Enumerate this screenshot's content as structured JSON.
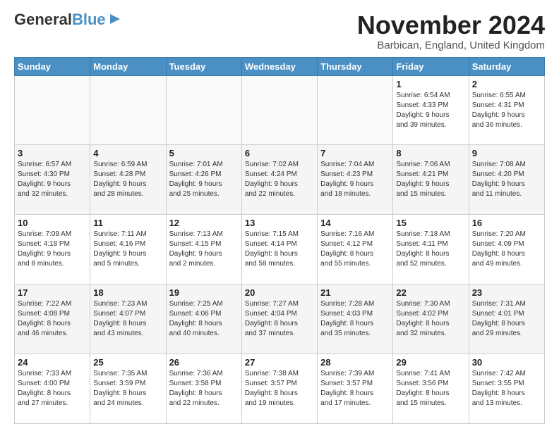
{
  "header": {
    "logo_line1": "General",
    "logo_line2": "Blue",
    "month": "November 2024",
    "location": "Barbican, England, United Kingdom"
  },
  "days_of_week": [
    "Sunday",
    "Monday",
    "Tuesday",
    "Wednesday",
    "Thursday",
    "Friday",
    "Saturday"
  ],
  "weeks": [
    [
      {
        "day": "",
        "info": ""
      },
      {
        "day": "",
        "info": ""
      },
      {
        "day": "",
        "info": ""
      },
      {
        "day": "",
        "info": ""
      },
      {
        "day": "",
        "info": ""
      },
      {
        "day": "1",
        "info": "Sunrise: 6:54 AM\nSunset: 4:33 PM\nDaylight: 9 hours\nand 39 minutes."
      },
      {
        "day": "2",
        "info": "Sunrise: 6:55 AM\nSunset: 4:31 PM\nDaylight: 9 hours\nand 36 minutes."
      }
    ],
    [
      {
        "day": "3",
        "info": "Sunrise: 6:57 AM\nSunset: 4:30 PM\nDaylight: 9 hours\nand 32 minutes."
      },
      {
        "day": "4",
        "info": "Sunrise: 6:59 AM\nSunset: 4:28 PM\nDaylight: 9 hours\nand 28 minutes."
      },
      {
        "day": "5",
        "info": "Sunrise: 7:01 AM\nSunset: 4:26 PM\nDaylight: 9 hours\nand 25 minutes."
      },
      {
        "day": "6",
        "info": "Sunrise: 7:02 AM\nSunset: 4:24 PM\nDaylight: 9 hours\nand 22 minutes."
      },
      {
        "day": "7",
        "info": "Sunrise: 7:04 AM\nSunset: 4:23 PM\nDaylight: 9 hours\nand 18 minutes."
      },
      {
        "day": "8",
        "info": "Sunrise: 7:06 AM\nSunset: 4:21 PM\nDaylight: 9 hours\nand 15 minutes."
      },
      {
        "day": "9",
        "info": "Sunrise: 7:08 AM\nSunset: 4:20 PM\nDaylight: 9 hours\nand 11 minutes."
      }
    ],
    [
      {
        "day": "10",
        "info": "Sunrise: 7:09 AM\nSunset: 4:18 PM\nDaylight: 9 hours\nand 8 minutes."
      },
      {
        "day": "11",
        "info": "Sunrise: 7:11 AM\nSunset: 4:16 PM\nDaylight: 9 hours\nand 5 minutes."
      },
      {
        "day": "12",
        "info": "Sunrise: 7:13 AM\nSunset: 4:15 PM\nDaylight: 9 hours\nand 2 minutes."
      },
      {
        "day": "13",
        "info": "Sunrise: 7:15 AM\nSunset: 4:14 PM\nDaylight: 8 hours\nand 58 minutes."
      },
      {
        "day": "14",
        "info": "Sunrise: 7:16 AM\nSunset: 4:12 PM\nDaylight: 8 hours\nand 55 minutes."
      },
      {
        "day": "15",
        "info": "Sunrise: 7:18 AM\nSunset: 4:11 PM\nDaylight: 8 hours\nand 52 minutes."
      },
      {
        "day": "16",
        "info": "Sunrise: 7:20 AM\nSunset: 4:09 PM\nDaylight: 8 hours\nand 49 minutes."
      }
    ],
    [
      {
        "day": "17",
        "info": "Sunrise: 7:22 AM\nSunset: 4:08 PM\nDaylight: 8 hours\nand 46 minutes."
      },
      {
        "day": "18",
        "info": "Sunrise: 7:23 AM\nSunset: 4:07 PM\nDaylight: 8 hours\nand 43 minutes."
      },
      {
        "day": "19",
        "info": "Sunrise: 7:25 AM\nSunset: 4:06 PM\nDaylight: 8 hours\nand 40 minutes."
      },
      {
        "day": "20",
        "info": "Sunrise: 7:27 AM\nSunset: 4:04 PM\nDaylight: 8 hours\nand 37 minutes."
      },
      {
        "day": "21",
        "info": "Sunrise: 7:28 AM\nSunset: 4:03 PM\nDaylight: 8 hours\nand 35 minutes."
      },
      {
        "day": "22",
        "info": "Sunrise: 7:30 AM\nSunset: 4:02 PM\nDaylight: 8 hours\nand 32 minutes."
      },
      {
        "day": "23",
        "info": "Sunrise: 7:31 AM\nSunset: 4:01 PM\nDaylight: 8 hours\nand 29 minutes."
      }
    ],
    [
      {
        "day": "24",
        "info": "Sunrise: 7:33 AM\nSunset: 4:00 PM\nDaylight: 8 hours\nand 27 minutes."
      },
      {
        "day": "25",
        "info": "Sunrise: 7:35 AM\nSunset: 3:59 PM\nDaylight: 8 hours\nand 24 minutes."
      },
      {
        "day": "26",
        "info": "Sunrise: 7:36 AM\nSunset: 3:58 PM\nDaylight: 8 hours\nand 22 minutes."
      },
      {
        "day": "27",
        "info": "Sunrise: 7:38 AM\nSunset: 3:57 PM\nDaylight: 8 hours\nand 19 minutes."
      },
      {
        "day": "28",
        "info": "Sunrise: 7:39 AM\nSunset: 3:57 PM\nDaylight: 8 hours\nand 17 minutes."
      },
      {
        "day": "29",
        "info": "Sunrise: 7:41 AM\nSunset: 3:56 PM\nDaylight: 8 hours\nand 15 minutes."
      },
      {
        "day": "30",
        "info": "Sunrise: 7:42 AM\nSunset: 3:55 PM\nDaylight: 8 hours\nand 13 minutes."
      }
    ]
  ]
}
